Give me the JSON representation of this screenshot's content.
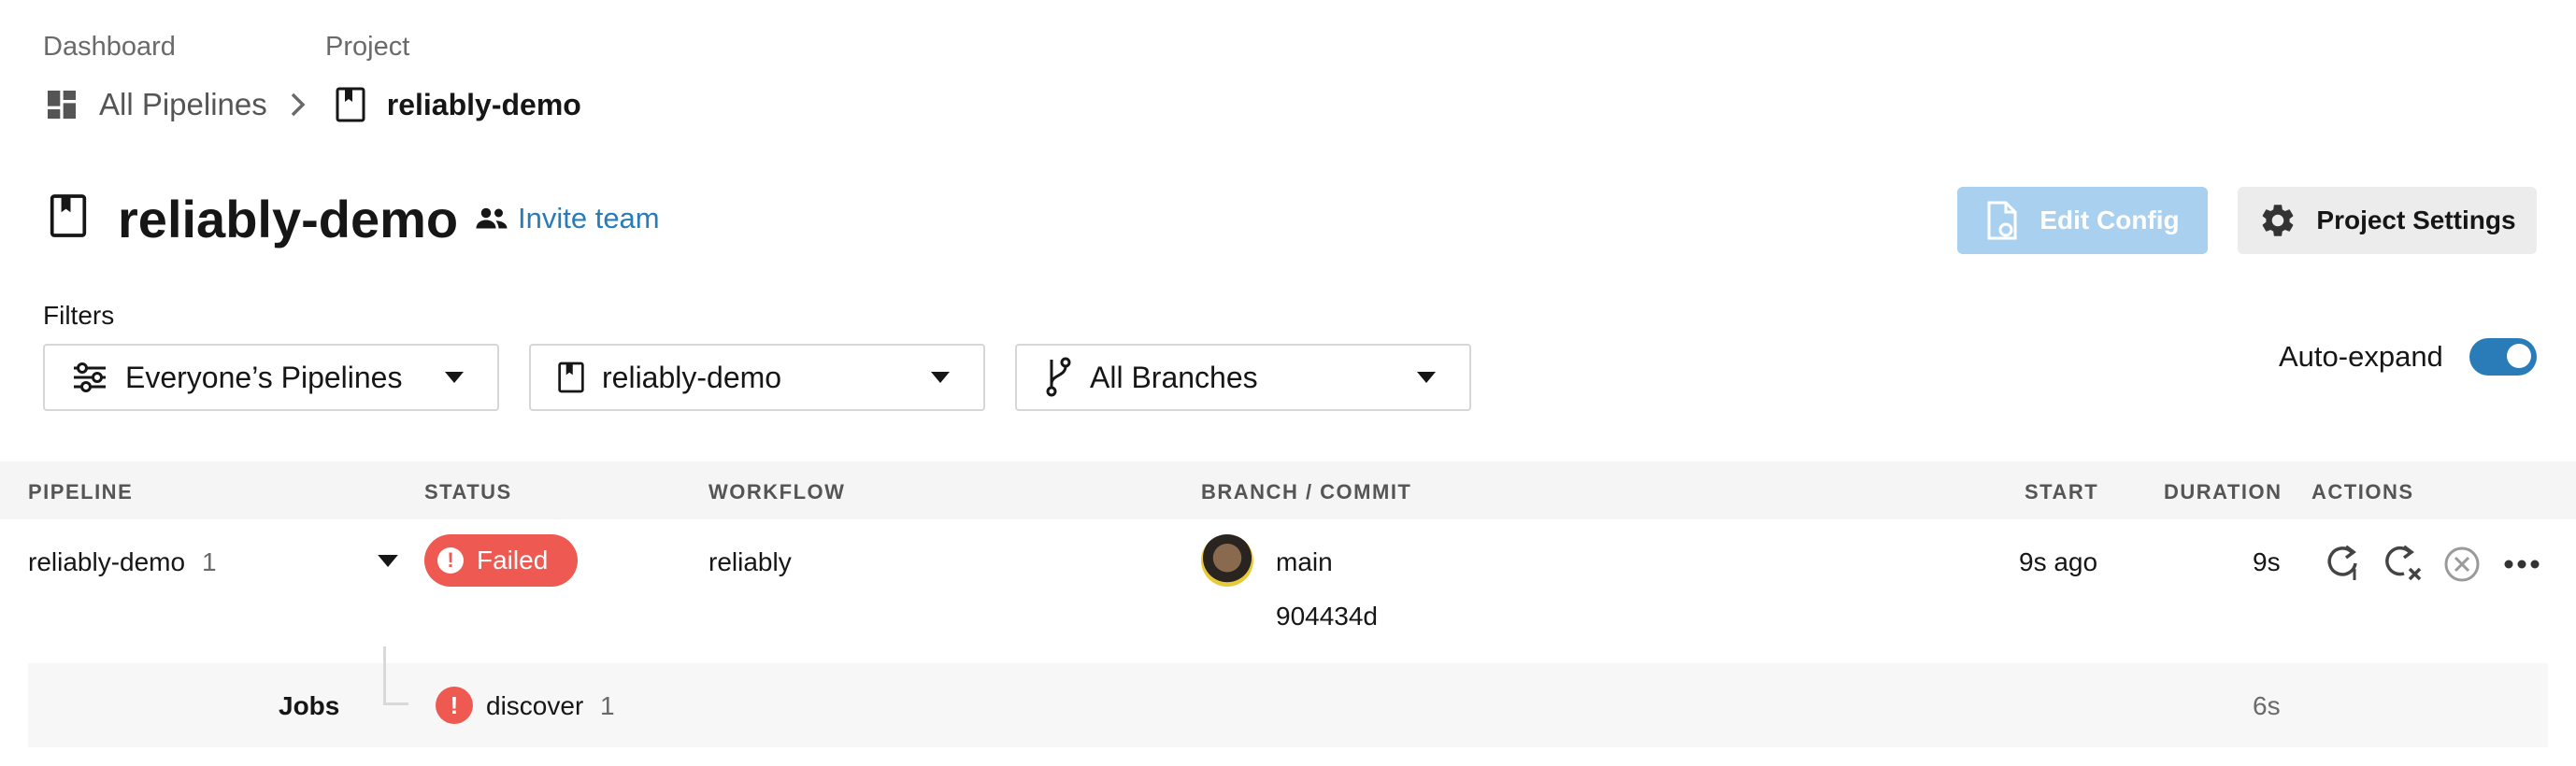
{
  "breadcrumb": {
    "dashboard_label": "Dashboard",
    "project_label": "Project",
    "all_pipelines": "All Pipelines",
    "project_name": "reliably-demo"
  },
  "header": {
    "title": "reliably-demo",
    "invite_team": "Invite team",
    "edit_config": "Edit Config",
    "project_settings": "Project Settings"
  },
  "filters": {
    "label": "Filters",
    "pipelines_filter": "Everyone’s Pipelines",
    "project_filter": "reliably-demo",
    "branch_filter": "All Branches",
    "auto_expand_label": "Auto-expand",
    "auto_expand_on": true
  },
  "table": {
    "headers": {
      "pipeline": "PIPELINE",
      "status": "STATUS",
      "workflow": "WORKFLOW",
      "branch_commit": "BRANCH / COMMIT",
      "start": "START",
      "duration": "DURATION",
      "actions": "ACTIONS"
    },
    "row": {
      "pipeline_name": "reliably-demo",
      "pipeline_number": "1",
      "status": "Failed",
      "workflow": "reliably",
      "branch": "main",
      "commit": "904434d",
      "start": "9s ago",
      "duration": "9s"
    },
    "jobs": {
      "label": "Jobs",
      "job_name": "discover",
      "job_number": "1",
      "job_duration": "6s"
    }
  },
  "colors": {
    "accent": "#2a7cb8",
    "failed": "#ee5a52",
    "edit_config_bg": "#a9d0ef",
    "settings_bg": "#ececec"
  },
  "icons": {
    "dashboard": "dashboard-icon",
    "chevron": "chevron-right-icon",
    "project": "bookmark-icon",
    "people": "people-icon",
    "file_gear": "file-gear-icon",
    "gear": "gear-icon",
    "filter": "filter-icon",
    "branch": "git-branch-icon",
    "caret": "caret-down-icon",
    "rerun": "rerun-icon",
    "rerun_failed": "rerun-failed-icon",
    "cancel": "cancel-icon",
    "more": "more-icon"
  }
}
